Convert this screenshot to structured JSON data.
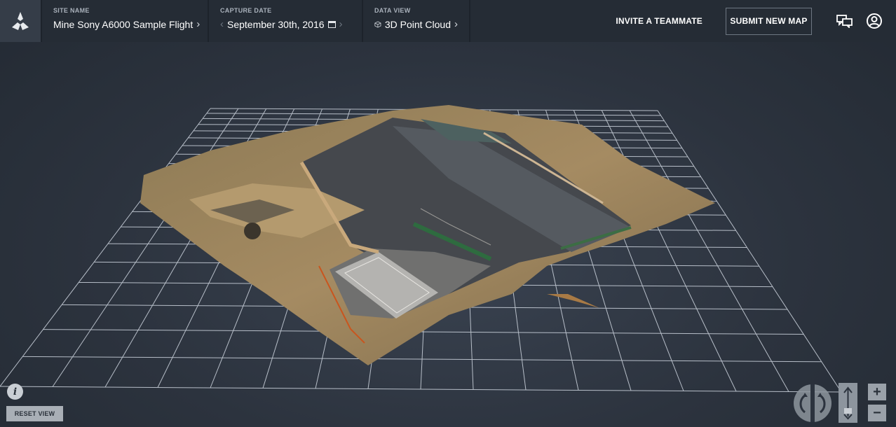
{
  "header": {
    "logo_icon": "airfleet-logo-icon",
    "site": {
      "label": "SITE NAME",
      "value": "Mine Sony A6000 Sample Flight"
    },
    "capture": {
      "label": "CAPTURE DATE",
      "value": "September 30th, 2016"
    },
    "data_view": {
      "label": "DATA VIEW",
      "value": "3D Point Cloud"
    },
    "invite_label": "INVITE A TEAMMATE",
    "submit_label": "SUBMIT NEW MAP",
    "chat_icon": "chat-bubbles-icon",
    "account_icon": "user-account-icon"
  },
  "viewer": {
    "content": "3d-point-cloud-on-grid",
    "reset_label": "RESET VIEW",
    "info_glyph": "i",
    "zoom_in_glyph": "+",
    "zoom_out_glyph": "−",
    "colors": {
      "grid": "#cfd6e0",
      "background": "#2c333e"
    }
  }
}
